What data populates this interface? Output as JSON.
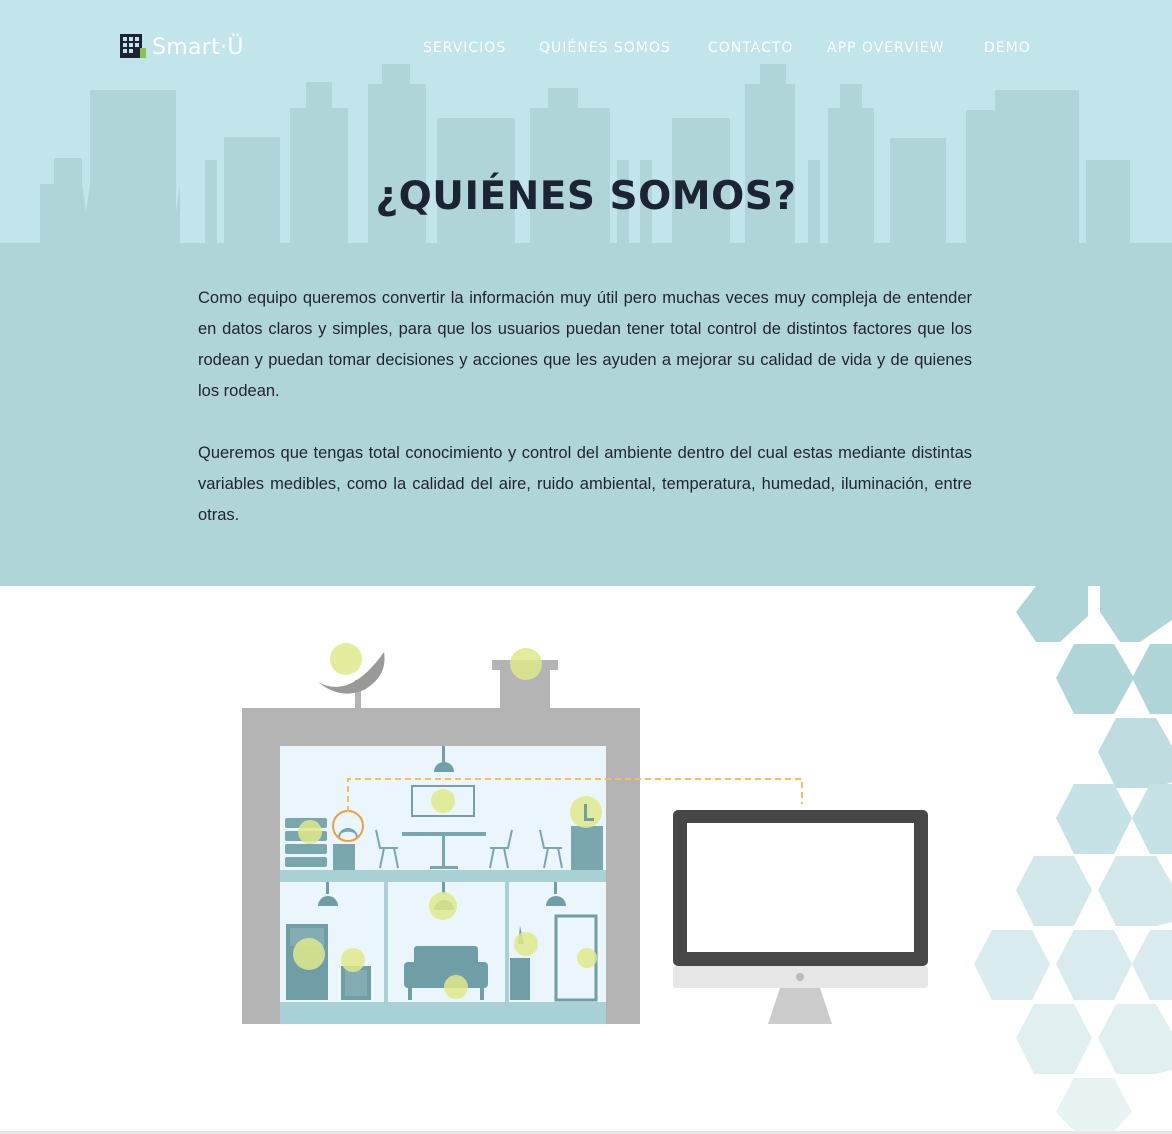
{
  "brand": {
    "name": "Smart·Ü"
  },
  "nav": {
    "items": [
      {
        "label": "SERVICIOS"
      },
      {
        "label": "QUIÉNES SOMOS"
      },
      {
        "label": "CONTACTO"
      },
      {
        "label": "APP OVERVIEW"
      },
      {
        "label": "DEMO"
      }
    ]
  },
  "main": {
    "title": "¿QUIÉNES SOMOS?",
    "paragraphs": [
      "Como equipo queremos convertir la información muy útil pero muchas veces muy compleja de entender en datos claros y simples, para que los usuarios puedan tener total control de distintos factores que los rodean y puedan tomar decisiones y acciones que les ayuden a mejorar su calidad de vida y de quienes los rodean.",
      "Queremos que tengas total conocimiento y control del ambiente dentro del cual estas mediante distintas variables medibles, como la calidad del aire, ruido ambiental, temperatura, humedad, iluminación, entre otras."
    ]
  },
  "colors": {
    "sky": "#c2e5ec",
    "skyline": "#b0d5d9",
    "title": "#1c2333",
    "sensor": "#dfe98a",
    "building": "#b4b4b4",
    "monitor": "#4a4a4a"
  }
}
